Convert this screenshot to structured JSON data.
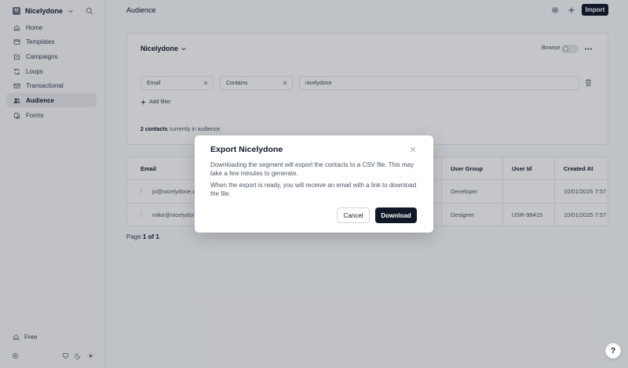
{
  "workspace": {
    "badge": "N",
    "name": "Nicelydone"
  },
  "sidebar": {
    "items": [
      {
        "label": "Home",
        "icon": "home-icon"
      },
      {
        "label": "Templates",
        "icon": "templates-icon"
      },
      {
        "label": "Campaigns",
        "icon": "campaigns-icon"
      },
      {
        "label": "Loops",
        "icon": "loops-icon"
      },
      {
        "label": "Transactional",
        "icon": "transactional-icon"
      },
      {
        "label": "Audience",
        "icon": "audience-icon",
        "active": true
      },
      {
        "label": "Forms",
        "icon": "forms-icon"
      }
    ],
    "plan_label": "Free"
  },
  "header": {
    "title": "Audience",
    "import_label": "Import"
  },
  "segment": {
    "name": "Nicelydone",
    "browse_label": "Browse",
    "filters": [
      {
        "value": "Email"
      },
      {
        "value": "Contains"
      },
      {
        "value": "nicelydone"
      }
    ],
    "add_filter_label": "Add filter",
    "count_bold": "2 contacts",
    "count_rest": " currently in audience"
  },
  "table": {
    "columns": [
      "Email",
      "User Group",
      "User Id",
      "Created At"
    ],
    "rows": [
      {
        "email": "jo@nicelydone.c",
        "user_group": "Developer",
        "user_id": "",
        "created_at": "10/01/2025 7:57"
      },
      {
        "email": "mike@nicelydon",
        "user_group": "Designer",
        "user_id": "USR-98415",
        "created_at": "10/01/2025 7:57"
      }
    ]
  },
  "pager": {
    "prefix": "Page ",
    "value": "1 of 1"
  },
  "modal": {
    "title": "Export Nicelydone",
    "p1": "Downloading the segment will export the contacts to a CSV file. This may take a few minutes to generate.",
    "p2": "When the export is ready, you will receive an email with a link to download the file.",
    "cancel_label": "Cancel",
    "download_label": "Download"
  },
  "help_label": "?",
  "colors": {
    "primary": "#111827",
    "overlay": "rgba(20,28,44,0.25)",
    "active_nav": "#ececef"
  }
}
